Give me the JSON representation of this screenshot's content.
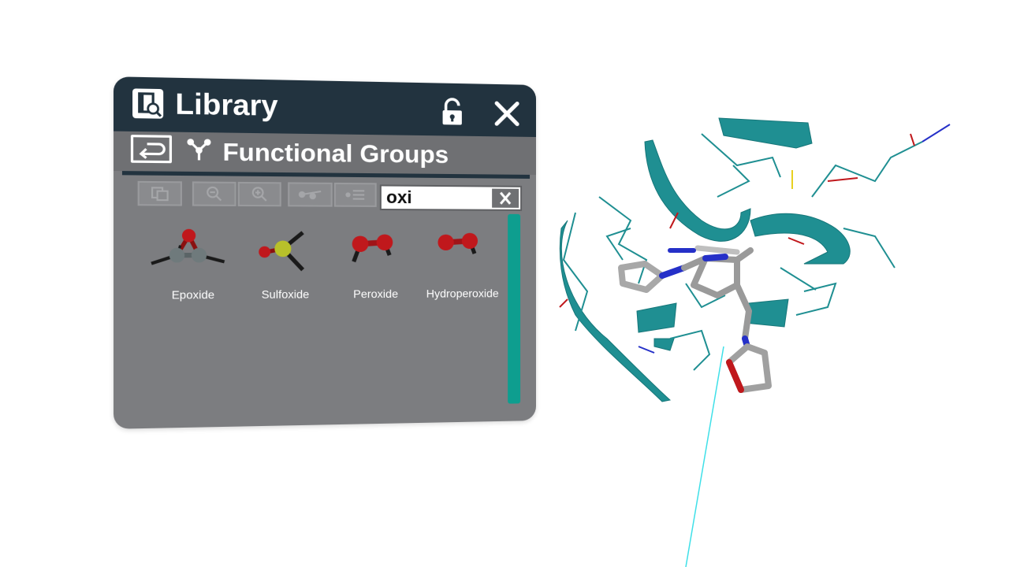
{
  "window": {
    "title": "Library",
    "icons": {
      "library": "library-search-icon",
      "lock": "unlock-icon",
      "close": "close-icon"
    }
  },
  "subheader": {
    "title": "Functional Groups",
    "icons": {
      "back": "back-arrow-icon",
      "group": "functional-group-icon"
    }
  },
  "toolbar": {
    "buttons": [
      {
        "name": "copy-icon"
      },
      {
        "name": "zoom-out-icon"
      },
      {
        "name": "zoom-in-icon"
      },
      {
        "name": "bond-icon"
      },
      {
        "name": "list-icon"
      }
    ]
  },
  "search": {
    "value": "oxi",
    "clear_icon": "clear-icon"
  },
  "results": [
    {
      "label": "Epoxide"
    },
    {
      "label": "Sulfoxide"
    },
    {
      "label": "Peroxide"
    },
    {
      "label": "Hydroperoxide"
    }
  ],
  "colors": {
    "title_bar": "#22333f",
    "panel": "#7c7d80",
    "scrollbar": "#0e9e8f",
    "protein": "#1f8f92",
    "oxygen": "#c0181c",
    "sulfur": "#b8c02a",
    "nitrogen": "#2530c8",
    "carbon": "#9a9a9a"
  }
}
